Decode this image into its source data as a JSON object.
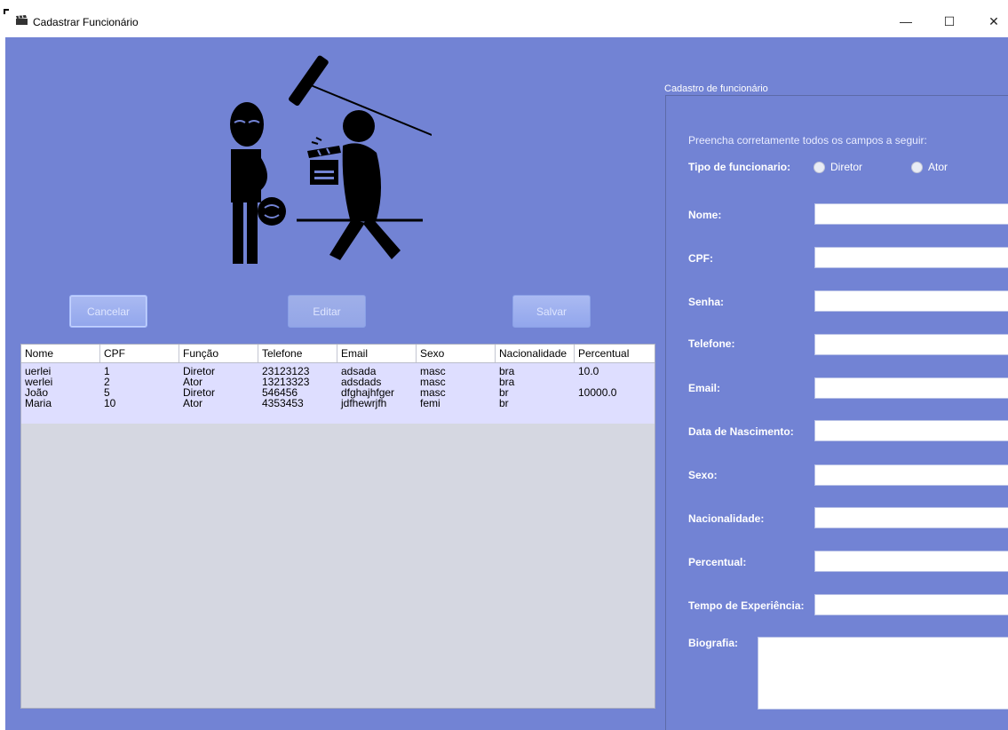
{
  "window": {
    "title": "Cadastrar Funcionário",
    "controls": [
      "—",
      "☐",
      "✕"
    ]
  },
  "buttons": {
    "cancel": "Cancelar",
    "edit": "Editar",
    "save": "Salvar"
  },
  "table": {
    "columns": [
      "Nome",
      "CPF",
      "Função",
      "Telefone",
      "Email",
      "Sexo",
      "Nacionalidade",
      "Percentual"
    ],
    "rows": [
      [
        "uerlei",
        "1",
        "Diretor",
        "23123123",
        "adsada",
        "masc",
        "bra",
        "10.0"
      ],
      [
        "werlei",
        "2",
        "Ator",
        "13213323",
        "adsdads",
        "masc",
        "bra",
        ""
      ],
      [
        "João",
        "5",
        "Diretor",
        "546456",
        "dfghajhfger",
        "masc",
        "br",
        "10000.0"
      ],
      [
        "Maria",
        "10",
        "Ator",
        "4353453",
        "jdfhewrjfh",
        "femi",
        "br",
        ""
      ]
    ]
  },
  "form": {
    "panel_title": "Cadastro de funcionário",
    "instruction": "Preencha corretamente todos os campos a seguir:",
    "type_label": "Tipo de funcionario:",
    "type_options": [
      "Diretor",
      "Ator"
    ],
    "fields": {
      "nome": "Nome:",
      "cpf": "CPF:",
      "senha": "Senha:",
      "telefone": "Telefone:",
      "email": "Email:",
      "nascimento": "Data de Nascimento:",
      "sexo": "Sexo:",
      "nacionalidade": "Nacionalidade:",
      "percentual": "Percentual:",
      "experiencia": "Tempo de Experiência:",
      "biografia": "Biografia:"
    }
  },
  "colors": {
    "background": "#7283d4",
    "table_rows": "#dedeff",
    "table_empty": "#d5d7e1"
  }
}
